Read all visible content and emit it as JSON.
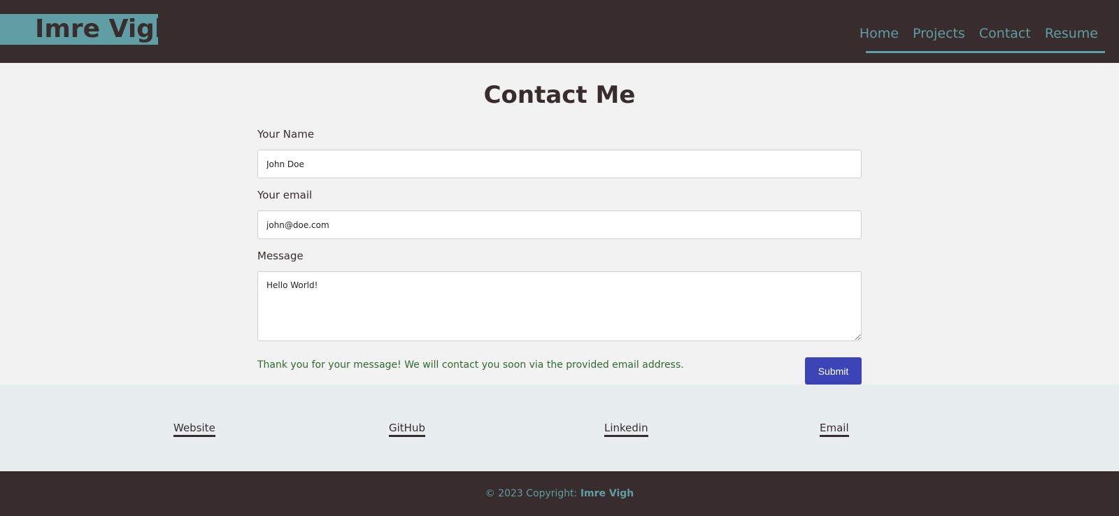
{
  "header": {
    "brand": "Imre Vigh",
    "nav": [
      {
        "label": "Home"
      },
      {
        "label": "Projects"
      },
      {
        "label": "Contact"
      },
      {
        "label": "Resume"
      }
    ]
  },
  "main": {
    "title": "Contact Me",
    "name_label": "Your Name",
    "name_value": "John Doe",
    "email_label": "Your email",
    "email_value": "john@doe.com",
    "message_label": "Message",
    "message_value": "Hello World!",
    "thanks": "Thank you for your message! We will contact you soon via the provided email address.",
    "submit_label": "Submit"
  },
  "links": [
    {
      "label": "Website"
    },
    {
      "label": "GitHub"
    },
    {
      "label": "Linkedin"
    },
    {
      "label": "Email"
    }
  ],
  "footer": {
    "copyright_prefix": "© 2023 Copyright: ",
    "copyright_name": "Imre Vigh"
  },
  "colors": {
    "dark": "#382c2c",
    "accent": "#5e9ea4",
    "button": "#3a44b6",
    "success": "#2e6b2e"
  }
}
